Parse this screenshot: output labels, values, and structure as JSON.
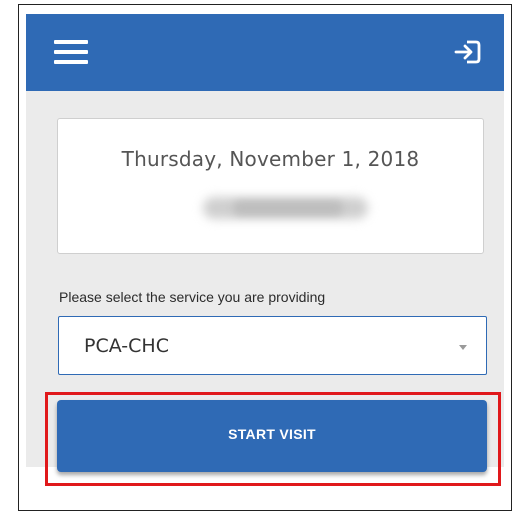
{
  "header": {
    "menu_icon": "hamburger-menu-icon",
    "logout_icon": "sign-in-arrow-icon",
    "color": "#2f6ab5"
  },
  "visit_card": {
    "date": "Thursday, November 1, 2018"
  },
  "service": {
    "label": "Please select the service you are providing",
    "selected": "PCA-CHC"
  },
  "actions": {
    "start_visit_label": "START VISIT"
  },
  "colors": {
    "accent": "#2f6ab5",
    "highlight": "#e0181b",
    "background": "#ebebeb"
  }
}
